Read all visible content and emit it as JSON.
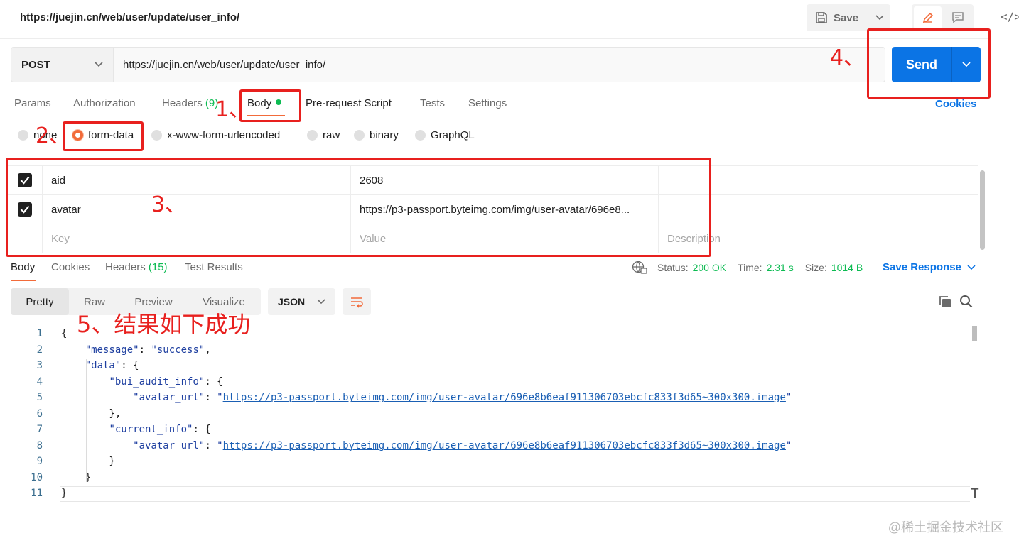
{
  "header": {
    "url_title": "https://juejin.cn/web/user/update/user_info/",
    "save_label": "Save",
    "side_code_icon": "</>"
  },
  "request": {
    "method": "POST",
    "url": "https://juejin.cn/web/user/update/user_info/",
    "send_label": "Send"
  },
  "tabs": [
    {
      "label": "Params"
    },
    {
      "label": "Authorization"
    },
    {
      "label": "Headers",
      "count": "(9)"
    },
    {
      "label": "Body",
      "active": true
    },
    {
      "label": "Pre-request Script"
    },
    {
      "label": "Tests"
    },
    {
      "label": "Settings"
    }
  ],
  "cookies_label": "Cookies",
  "body_types": [
    {
      "label": "none",
      "selected": false
    },
    {
      "label": "form-data",
      "selected": true
    },
    {
      "label": "x-www-form-urlencoded",
      "selected": false
    },
    {
      "label": "raw",
      "selected": false
    },
    {
      "label": "binary",
      "selected": false
    },
    {
      "label": "GraphQL",
      "selected": false
    }
  ],
  "form_rows": [
    {
      "checked": true,
      "key": "aid",
      "value": "2608",
      "description": ""
    },
    {
      "checked": true,
      "key": "avatar",
      "value": "https://p3-passport.byteimg.com/img/user-avatar/696e8...",
      "description": ""
    }
  ],
  "form_placeholders": {
    "key": "Key",
    "value": "Value",
    "description": "Description"
  },
  "response": {
    "tabs": [
      {
        "label": "Body",
        "active": true
      },
      {
        "label": "Cookies"
      },
      {
        "label": "Headers",
        "count": "(15)"
      },
      {
        "label": "Test Results"
      }
    ],
    "status_label": "Status:",
    "status_value": "200 OK",
    "time_label": "Time:",
    "time_value": "2.31 s",
    "size_label": "Size:",
    "size_value": "1014 B",
    "save_response_label": "Save Response"
  },
  "view_modes": [
    "Pretty",
    "Raw",
    "Preview",
    "Visualize"
  ],
  "active_view": "Pretty",
  "format": "JSON",
  "code_lines": [
    "1",
    "2",
    "3",
    "4",
    "5",
    "6",
    "7",
    "8",
    "9",
    "10",
    "11"
  ],
  "json_body": {
    "message_key": "\"message\"",
    "message_val": "\"success\"",
    "data_key": "\"data\"",
    "bui_key": "\"bui_audit_info\"",
    "avatar_key": "\"avatar_url\"",
    "avatar_url": "https://p3-passport.byteimg.com/img/user-avatar/696e8b6eaf911306703ebcfc833f3d65~300x300.image",
    "current_key": "\"current_info\""
  },
  "annotations": {
    "step1": "1、",
    "step2": "2、",
    "step3": "3、",
    "step4": "4、",
    "step5": "5、结果如下成功"
  },
  "watermark": "@稀土掘金技术社区",
  "colors": {
    "accent_orange": "#f26b3a",
    "send_blue": "#0b74e5",
    "success_green": "#0cbb52",
    "annotation_red": "#e8201e"
  }
}
